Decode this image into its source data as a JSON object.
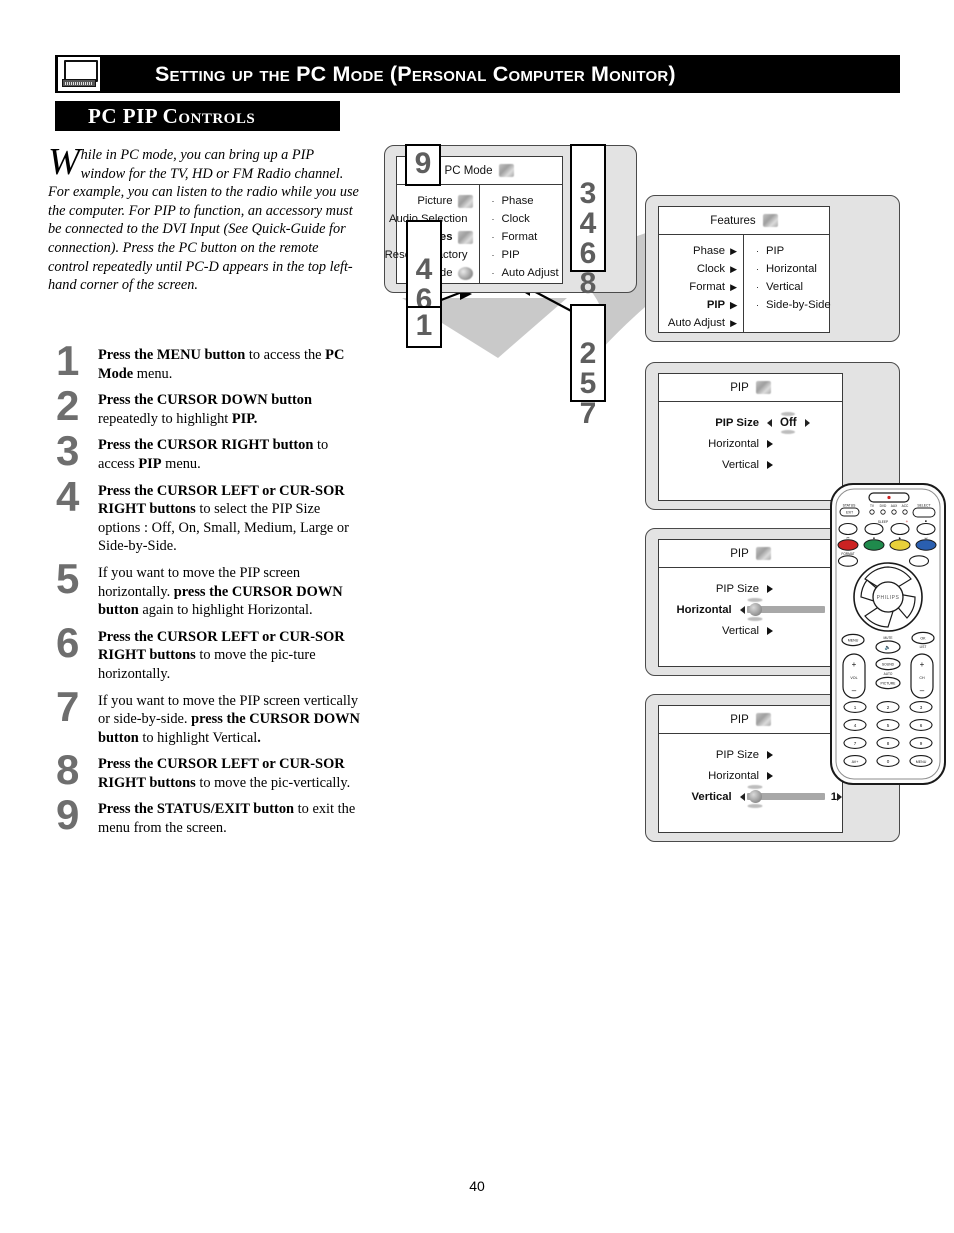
{
  "header": {
    "icon": "computer-monitor-icon",
    "title": "Setting up the PC Mode (Personal Computer Monitor)"
  },
  "section": {
    "title": "PC PIP Controls"
  },
  "intro": {
    "dropcap": "W",
    "paragraph": "hile in PC mode, you can bring up a PIP window for the TV, HD or FM Radio channel. For example, you can listen to the radio while you use the computer. For PIP to function, an accessory must be connected to the DVI Input (See Quick-Guide for connection). Press the PC button on the remote control repeatedly until PC-D appears in the top left-hand corner of the screen."
  },
  "steps": [
    {
      "num": "1",
      "html": "<b>Press the MENU button</b> to access the <b>PC Mode</b> menu."
    },
    {
      "num": "2",
      "html": "<b>Press the CURSOR DOWN button</b> repeatedly to highlight <b>PIP.</b>"
    },
    {
      "num": "3",
      "html": "<b>Press the CURSOR RIGHT button</b> to access <b>PIP</b> menu."
    },
    {
      "num": "4",
      "html": "<b>Press the CURSOR LEFT or CUR-SOR RIGHT buttons</b> to select the PIP Size options : Off, On, Small, Medium, Large or Side-by-Side."
    },
    {
      "num": "5",
      "html": "If you want to move the PIP screen horizontally. <b>press the CURSOR DOWN button</b> again to highlight Horizontal."
    },
    {
      "num": "6",
      "html": "<b>Press the CURSOR LEFT or CUR-SOR RIGHT buttons</b> to move the pic-ture horizontally."
    },
    {
      "num": "7",
      "html": "If you want to move the PIP screen vertically or side-by-side. <b>press the CURSOR DOWN button</b> to highlight Vertical<b>.</b>"
    },
    {
      "num": "8",
      "html": "<b>Press the CURSOR LEFT or CUR-SOR RIGHT buttons</b> to move the pic-vertically."
    },
    {
      "num": "9",
      "html": "<b>Press the STATUS/EXIT button</b> to exit the menu from the screen."
    }
  ],
  "menus": {
    "pc_mode": {
      "title": "PC Mode",
      "left_items": [
        {
          "label": "Picture",
          "bold": false
        },
        {
          "label": "Audio Selection",
          "bold": false
        },
        {
          "label": "Features",
          "bold": true
        },
        {
          "label": "Reset to Factory",
          "bold": false
        },
        {
          "label": "Mode",
          "bold": false
        }
      ],
      "right_items": [
        "Phase",
        "Clock",
        "Format",
        "PIP",
        "Auto Adjust"
      ]
    },
    "features": {
      "title": "Features",
      "left_items": [
        {
          "label": "Phase",
          "bold": false
        },
        {
          "label": "Clock",
          "bold": false
        },
        {
          "label": "Format",
          "bold": false
        },
        {
          "label": "PIP",
          "bold": true
        },
        {
          "label": "Auto Adjust",
          "bold": false
        }
      ],
      "right_items": [
        "PIP",
        "Horizontal",
        "Vertical",
        "Side-by-Side"
      ]
    },
    "pip_size": {
      "title": "PIP",
      "rows": [
        {
          "label": "PIP Size",
          "bold": true,
          "control": "value",
          "value": "Off"
        },
        {
          "label": "Horizontal",
          "bold": false,
          "control": "caret"
        },
        {
          "label": "Vertical",
          "bold": false,
          "control": "caret"
        }
      ]
    },
    "pip_horizontal": {
      "title": "PIP",
      "rows": [
        {
          "label": "PIP Size",
          "bold": false,
          "control": "caret"
        },
        {
          "label": "Horizontal",
          "bold": true,
          "control": "slider",
          "value": "1"
        },
        {
          "label": "Vertical",
          "bold": false,
          "control": "caret"
        }
      ]
    },
    "pip_vertical": {
      "title": "PIP",
      "rows": [
        {
          "label": "PIP Size",
          "bold": false,
          "control": "caret"
        },
        {
          "label": "Horizontal",
          "bold": false,
          "control": "caret"
        },
        {
          "label": "Vertical",
          "bold": true,
          "control": "slider",
          "value": "1"
        }
      ]
    }
  },
  "callouts": {
    "exit": "9",
    "cursor_right": "3\n4\n6\n8",
    "cursor_left": "4\n6\n8",
    "menu": "1",
    "cursor_down": "2\n5\n7"
  },
  "remote": {
    "brand": "PHILIPS",
    "labels": {
      "status_exit": "STATUS\nEXIT",
      "select": "SELECT",
      "sources": [
        "TV",
        "DVD",
        "AUX",
        "ACC"
      ],
      "sleep": "SLEEP",
      "format": "FORMAT",
      "menu": "MENU",
      "ok": "OK",
      "list": "LIST",
      "mute": "MUTE",
      "vol": "VOL",
      "ch": "CH",
      "sound": "SOUND",
      "auto": "AUTO",
      "picture": "PICTURE",
      "keys": [
        "1",
        "2",
        "3",
        "4",
        "5",
        "6",
        "7",
        "8",
        "9",
        "AV+",
        "0",
        "MENU"
      ]
    },
    "colors": {
      "red": "#cc2222",
      "green": "#1f8a4c",
      "yellow": "#e8d13a",
      "blue": "#2a5fb0"
    }
  },
  "page": {
    "number": "40"
  },
  "colors": {
    "header_bg": "#000000",
    "header_text": "#ffffff",
    "step_number": "#6e6e6e",
    "panel_bg": "#e3e3e3",
    "osd_bg": "#ffffff",
    "arrow_gray": "#b5b5b5"
  }
}
